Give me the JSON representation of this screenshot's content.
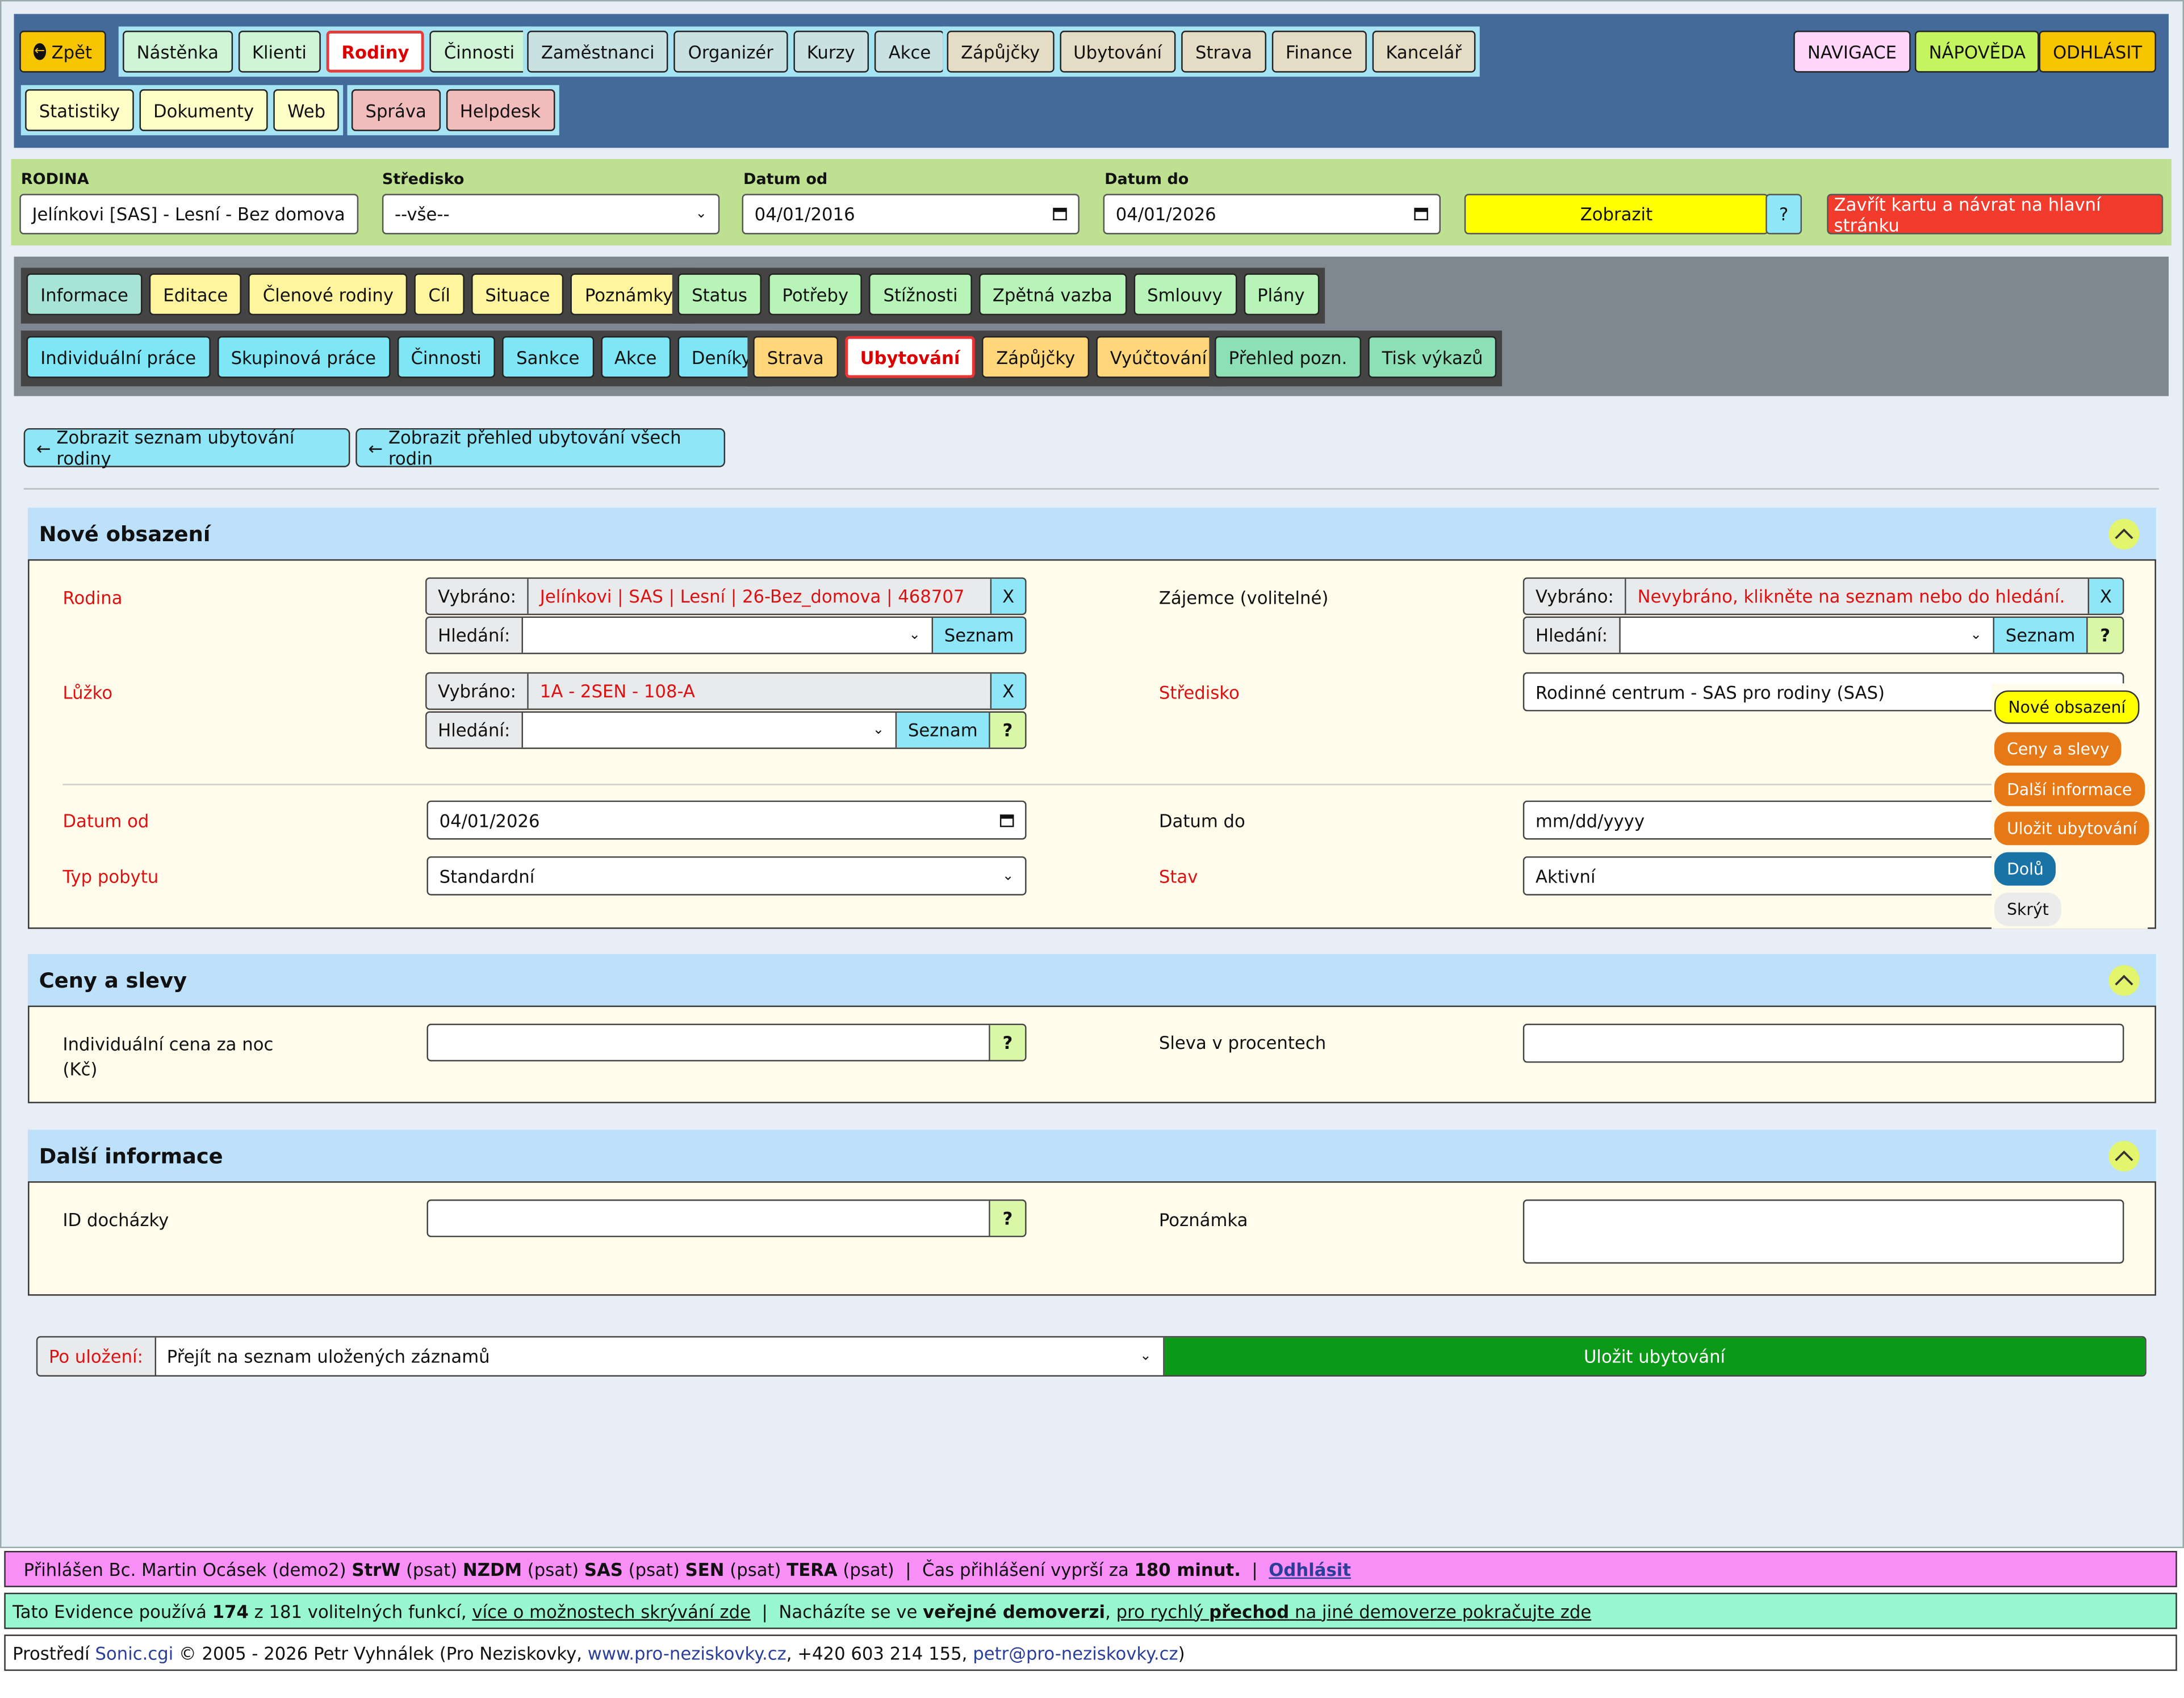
{
  "topnav": {
    "back": "Zpět",
    "g1": [
      "Nástěnka",
      "Klienti",
      "Rodiny",
      "Činnosti"
    ],
    "g2": [
      "Zaměstnanci",
      "Organizér",
      "Kurzy",
      "Akce"
    ],
    "g3": [
      "Zápůjčky",
      "Ubytování",
      "Strava",
      "Finance",
      "Kancelář"
    ],
    "g4": [
      "Statistiky",
      "Dokumenty",
      "Web"
    ],
    "g5": [
      "Správa",
      "Helpdesk"
    ],
    "navigace": "NAVIGACE",
    "napoveda": "NÁPOVĚDA",
    "odhlasit": "ODHLÁSIT"
  },
  "filter": {
    "rodina_label": "RODINA",
    "rodina_value": "Jelínkovi [SAS] - Lesní - Bez domova",
    "stredisko_label": "Středisko",
    "stredisko_value": "--vše--",
    "od_label": "Datum od",
    "od_value": "04/01/2016",
    "do_label": "Datum do",
    "do_value": "04/01/2026",
    "zobrazit": "Zobrazit",
    "help": "?",
    "zavrit": "Zavřít kartu a návrat na hlavní stránku"
  },
  "tabs": {
    "r1a": [
      "Informace",
      "Editace",
      "Členové rodiny",
      "Cíl",
      "Situace",
      "Poznámky"
    ],
    "r1b": [
      "Status",
      "Potřeby",
      "Stížnosti",
      "Zpětná vazba",
      "Smlouvy",
      "Plány"
    ],
    "r2a": [
      "Individuální práce",
      "Skupinová práce",
      "Činnosti",
      "Sankce",
      "Akce",
      "Deníky"
    ],
    "r2b": [
      "Strava",
      "Ubytování",
      "Zápůjčky",
      "Vyúčtování"
    ],
    "r2c": [
      "Přehled pozn.",
      "Tisk výkazů"
    ]
  },
  "back_buttons": [
    "Zobrazit seznam ubytování rodiny",
    "Zobrazit přehled ubytování všech rodin"
  ],
  "sec1": {
    "title": "Nové obsazení",
    "rodina": "Rodina",
    "vybrano": "Vybráno:",
    "hledani": "Hledání:",
    "rodina_sel": "Jelínkovi | SAS | Lesní | 26-Bez_domova | 468707",
    "x": "X",
    "seznam": "Seznam",
    "q": "?",
    "zajemce": "Zájemce (volitelné)",
    "zajemce_sel": "Nevybráno, klikněte na seznam nebo do hledání.",
    "luzko": "Lůžko",
    "luzko_sel": "1A - 2SEN - 108-A",
    "stredisko": "Středisko",
    "stredisko_val": "Rodinné centrum - SAS pro rodiny (SAS)",
    "datum_od": "Datum od",
    "datum_od_val": "04/01/2026",
    "datum_do": "Datum do",
    "datum_do_val": "mm/dd/yyyy",
    "typ": "Typ pobytu",
    "typ_val": "Standardní",
    "stav": "Stav",
    "stav_val": "Aktivní"
  },
  "sec2": {
    "title": "Ceny a slevy",
    "cena": "Individuální cena za noc",
    "cena2": "(Kč)",
    "sleva": "Sleva v procentech",
    "q": "?"
  },
  "sec3": {
    "title": "Další informace",
    "id": "ID docházky",
    "pozn": "Poznámka",
    "q": "?"
  },
  "floating": [
    "Nové obsazení",
    "Ceny a slevy",
    "Další informace",
    "Uložit ubytování",
    "Dolů",
    "Skrýt"
  ],
  "save": {
    "label": "Po uložení:",
    "option": "Přejít na seznam uložených záznamů",
    "button": "Uložit ubytování"
  },
  "footer": {
    "f1_a": "Přihlášen Bc. Martin Ocásek (demo2) ",
    "f1_strw": "StrW",
    "f1_psat": " (psat) ",
    "f1_nzdm": "NZDM",
    "f1_sas": "SAS",
    "f1_sen": "SEN",
    "f1_tera": "TERA",
    "f1_cas": " (psat)  |  Čas přihlášení vyprší za ",
    "f1_min": "180 minut.",
    "f1_sep": "  |  ",
    "f1_odh": "Odhlásit",
    "f2_a": "Tato Evidence používá ",
    "f2_n": "174",
    "f2_b": " z 181 volitelných funkcí, ",
    "f2_link": "více o možnostech skrývání zde",
    "f2_c": "  |  Nacházíte se ve ",
    "f2_d": "veřejné demoverzi",
    ", ": "",
    "f2_e": ", ",
    "f2_f": "pro rychlý ",
    "f2_g": "přechod",
    "f2_h": " na jiné demoverze pokračujte zde",
    "f3_a": "Prostředí ",
    "f3_sonic": "Sonic.cgi",
    "f3_b": " © 2005 - 2026 Petr Vyhnálek (Pro Neziskovky, ",
    "f3_web": "www.pro-neziskovky.cz",
    "f3_c": ", +420 603 214 155, ",
    "f3_mail": "petr@pro-neziskovky.cz",
    "f3_d": ")"
  }
}
